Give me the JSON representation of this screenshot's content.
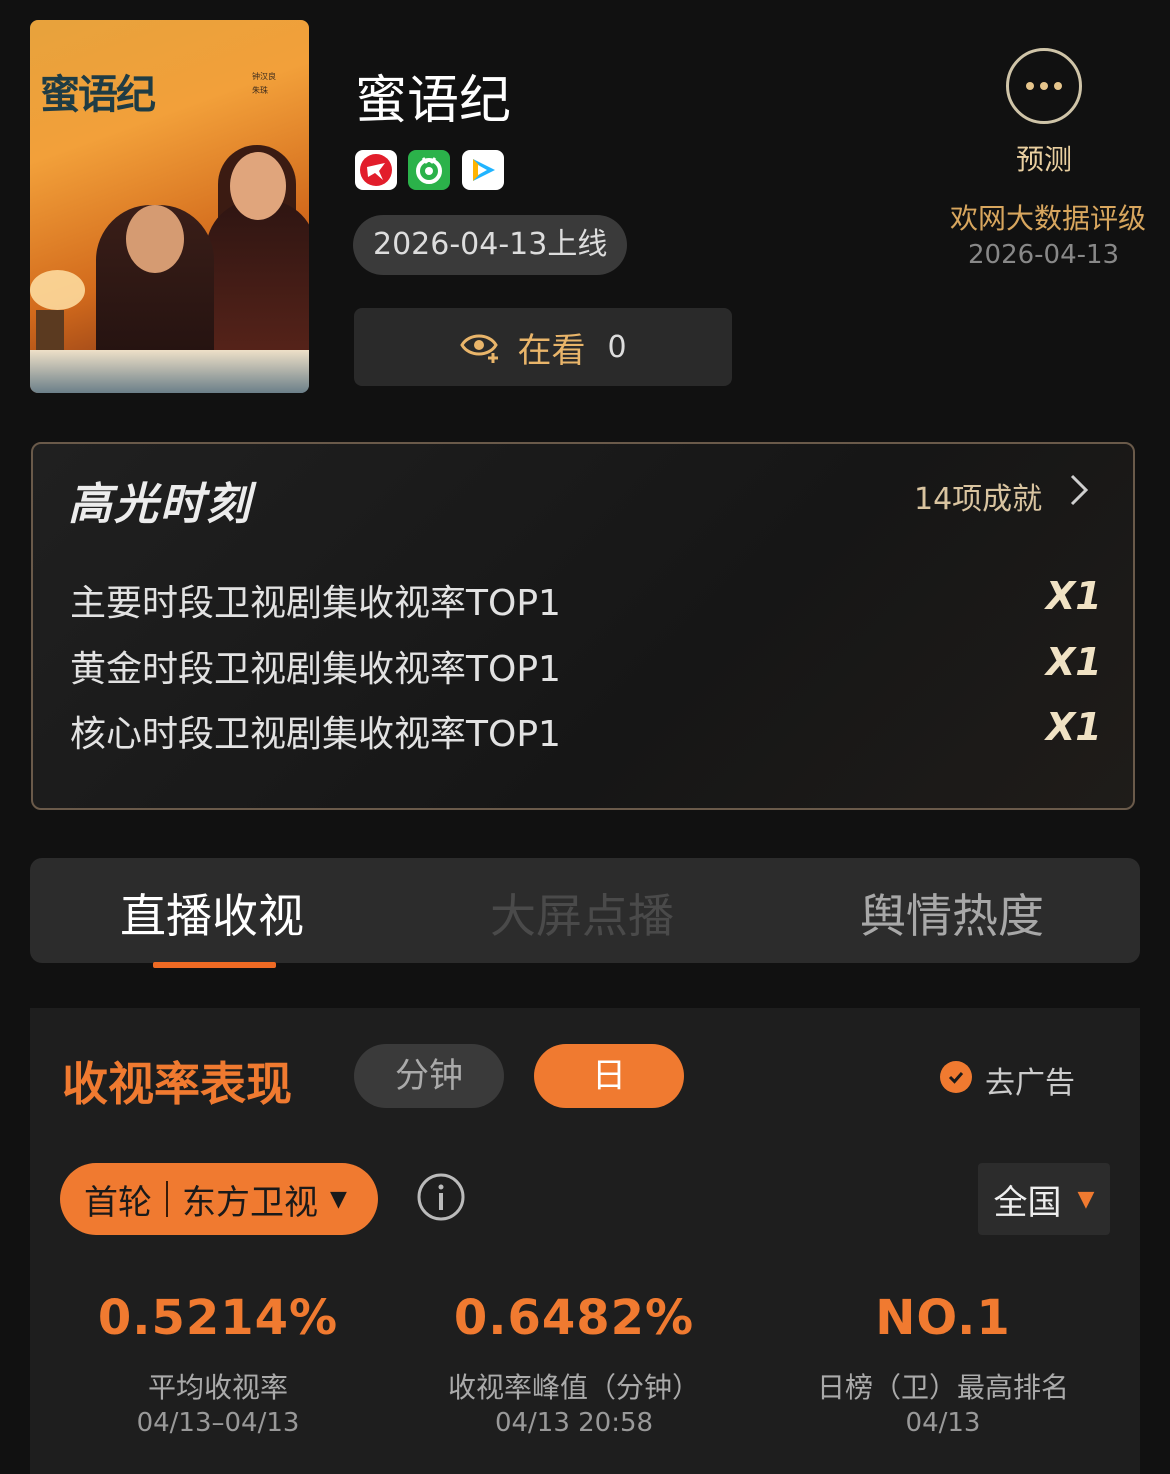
{
  "show": {
    "title": "蜜语纪",
    "poster_title": "蜜语纪",
    "poster_credits": [
      "钟汉良",
      "朱珠"
    ],
    "release": "2026-04-13上线",
    "platforms": [
      "dragon-tv-icon",
      "mango-style-icon",
      "tencent-video-icon"
    ],
    "watching": {
      "label": "在看",
      "count": "0"
    }
  },
  "predict": {
    "label": "预测",
    "rating_label": "欢网大数据评级",
    "rating_date": "2026-04-13"
  },
  "highlights": {
    "title": "高光时刻",
    "count": "14项成就",
    "items": [
      {
        "label": "主要时段卫视剧集收视率TOP1",
        "mult": "X1"
      },
      {
        "label": "黄金时段卫视剧集收视率TOP1",
        "mult": "X1"
      },
      {
        "label": "核心时段卫视剧集收视率TOP1",
        "mult": "X1"
      }
    ]
  },
  "tabs": [
    "直播收视",
    "大屏点播",
    "舆情热度"
  ],
  "ratings": {
    "title": "收视率表现",
    "modes": [
      "分钟",
      "日"
    ],
    "ad_label": "去广告",
    "channel": {
      "type": "首轮",
      "name": "东方卫视"
    },
    "region": "全国",
    "stats": [
      {
        "value": "0.5214%",
        "label": "平均收视率",
        "date": "04/13–04/13"
      },
      {
        "value": "0.6482%",
        "label": "收视率峰值（分钟）",
        "date": "04/13 20:58"
      },
      {
        "value": "NO.1",
        "label": "日榜（卫）最高排名",
        "date": "04/13"
      }
    ]
  },
  "colors": {
    "accent": "#f07a30",
    "gold": "#e9b56a",
    "background": "#111111"
  }
}
